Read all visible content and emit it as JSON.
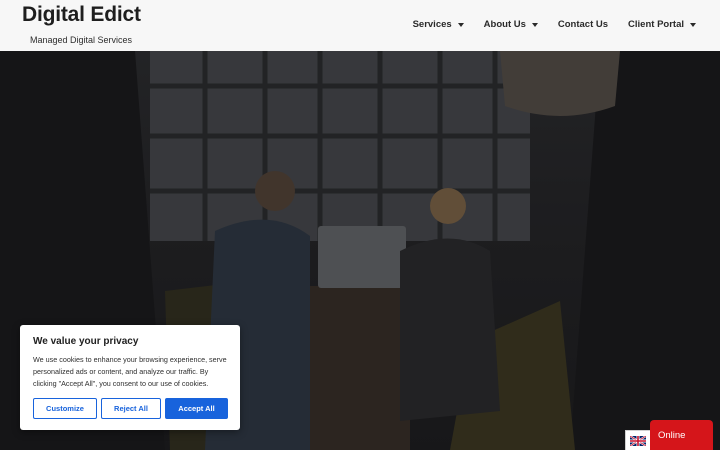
{
  "header": {
    "brand": "Digital Edict",
    "tagline": "Managed Digital Services",
    "nav": [
      {
        "label": "Services",
        "dropdown": true
      },
      {
        "label": "About Us",
        "dropdown": true
      },
      {
        "label": "Contact Us",
        "dropdown": false
      },
      {
        "label": "Client Portal",
        "dropdown": true
      }
    ]
  },
  "cookie_banner": {
    "title": "We value your privacy",
    "text": "We use cookies to enhance your browsing experience, serve personalized ads or content, and analyze our traffic. By clicking \"Accept All\", you consent to our use of cookies.",
    "customize_label": "Customize",
    "reject_label": "Reject All",
    "accept_label": "Accept All"
  },
  "widgets": {
    "language_flag": "uk-flag-icon",
    "chat_label": "Online"
  },
  "colors": {
    "accent": "#1863dc",
    "chat": "#d5151a",
    "header_bg": "#f7f7f7"
  }
}
